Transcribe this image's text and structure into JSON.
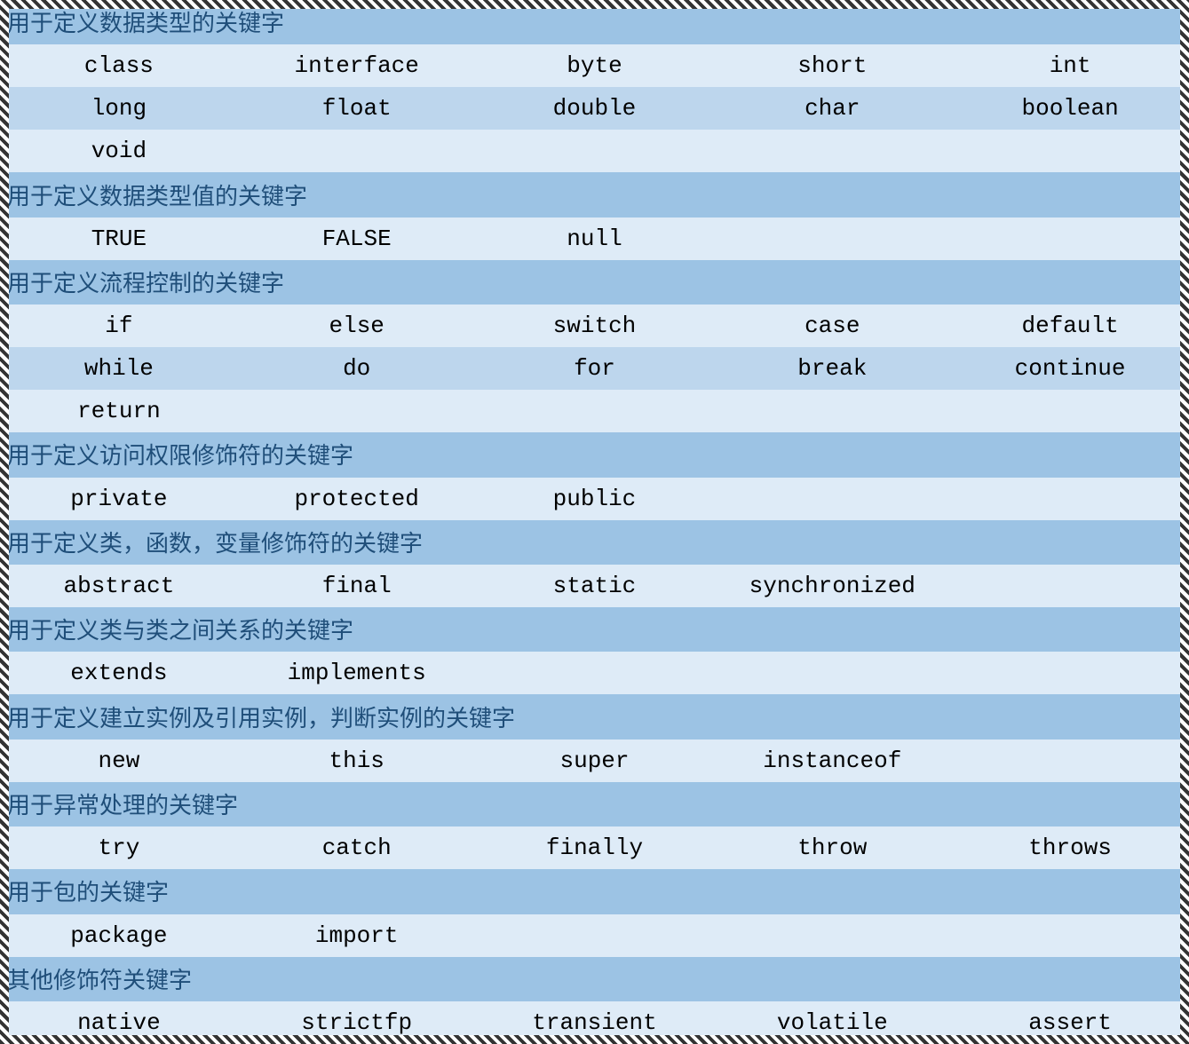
{
  "sections": [
    {
      "title": "用于定义数据类型的关键字",
      "rows": [
        [
          "class",
          "interface",
          "byte",
          "short",
          "int"
        ],
        [
          "long",
          "float",
          "double",
          "char",
          "boolean"
        ],
        [
          "void",
          "",
          "",
          "",
          ""
        ]
      ]
    },
    {
      "title": "用于定义数据类型值的关键字",
      "rows": [
        [
          "TRUE",
          "FALSE",
          "null",
          "",
          ""
        ]
      ]
    },
    {
      "title": "用于定义流程控制的关键字",
      "rows": [
        [
          "if",
          "else",
          "switch",
          "case",
          "default"
        ],
        [
          "while",
          "do",
          "for",
          "break",
          "continue"
        ],
        [
          "return",
          "",
          "",
          "",
          ""
        ]
      ]
    },
    {
      "title": "用于定义访问权限修饰符的关键字",
      "rows": [
        [
          "private",
          "protected",
          "public",
          "",
          ""
        ]
      ]
    },
    {
      "title": "用于定义类，函数，变量修饰符的关键字",
      "rows": [
        [
          "abstract",
          "final",
          "static",
          "synchronized",
          ""
        ]
      ]
    },
    {
      "title": "用于定义类与类之间关系的关键字",
      "rows": [
        [
          "extends",
          "implements",
          "",
          "",
          ""
        ]
      ]
    },
    {
      "title": "用于定义建立实例及引用实例，判断实例的关键字",
      "rows": [
        [
          "new",
          "this",
          "super",
          "instanceof",
          ""
        ]
      ]
    },
    {
      "title": "用于异常处理的关键字",
      "rows": [
        [
          "try",
          "catch",
          "finally",
          "throw",
          "throws"
        ]
      ]
    },
    {
      "title": "用于包的关键字",
      "rows": [
        [
          "package",
          "import",
          "",
          "",
          ""
        ]
      ]
    },
    {
      "title": "其他修饰符关键字",
      "rows": [
        [
          "native",
          "strictfp",
          "transient",
          "volatile",
          "assert"
        ]
      ]
    }
  ]
}
